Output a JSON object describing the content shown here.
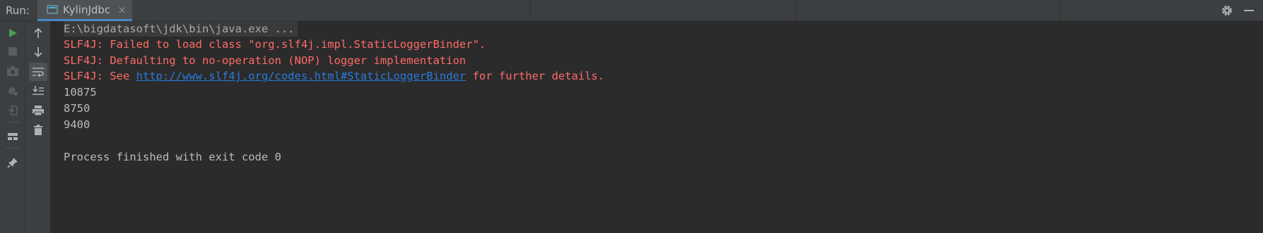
{
  "header": {
    "run_label": "Run:",
    "tab_label": "KylinJdbc",
    "tab_close": "×"
  },
  "toolbar": {
    "left": [
      "run-icon",
      "stop-icon",
      "camera-icon",
      "settings-bug-icon",
      "exit-icon",
      "layout-icon",
      "pin-icon"
    ],
    "right": [
      "arrow-up-icon",
      "arrow-down-icon",
      "soft-wrap-icon",
      "scroll-to-end-icon",
      "print-icon",
      "trash-icon"
    ]
  },
  "console": {
    "command": "E:\\bigdatasoft\\jdk\\bin\\java.exe ...",
    "err1": "SLF4J: Failed to load class \"org.slf4j.impl.StaticLoggerBinder\".",
    "err2": "SLF4J: Defaulting to no-operation (NOP) logger implementation",
    "err3_prefix": "SLF4J: See ",
    "err3_link": "http://www.slf4j.org/codes.html#StaticLoggerBinder",
    "err3_suffix": " for further details.",
    "out1": "10875",
    "out2": "8750",
    "out3": "9400",
    "finish": "Process finished with exit code 0"
  },
  "colors": {
    "background": "#2b2b2b",
    "panel": "#3c3f41",
    "error": "#ff6b68",
    "link": "#287bde",
    "text": "#bbbbbb",
    "run_green": "#499c54"
  }
}
